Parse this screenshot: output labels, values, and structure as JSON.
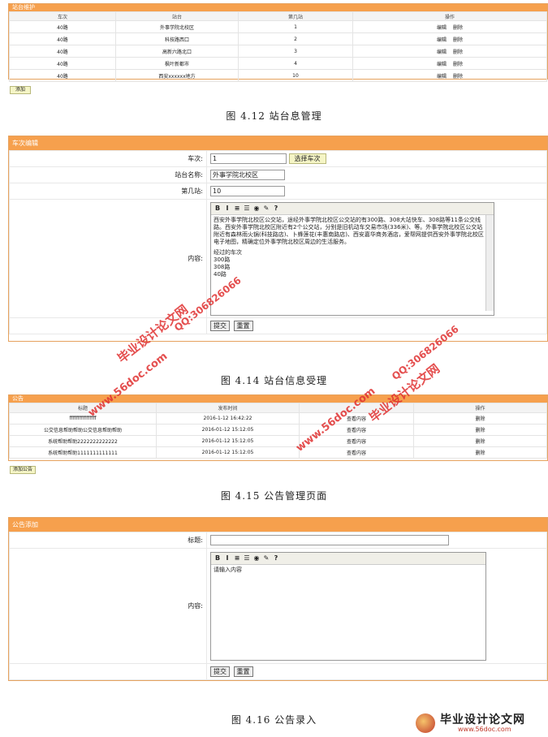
{
  "station_panel": {
    "title": "站台维护",
    "headers": [
      "车次",
      "站台",
      "第几站",
      "操作"
    ],
    "rows": [
      [
        "40路",
        "外事学院北校区",
        "1"
      ],
      [
        "40路",
        "科技路西口",
        "2"
      ],
      [
        "40路",
        "高新六路北口",
        "3"
      ],
      [
        "40路",
        "枫叶新都市",
        "4"
      ],
      [
        "40路",
        "西安xxxxxx地方",
        "10"
      ]
    ],
    "edit_label": "编辑",
    "delete_label": "删除",
    "add_label": "添加"
  },
  "caption1": "图 4.12 站台息管理",
  "bus_edit": {
    "title": "车次编辑",
    "bus_label": "车次:",
    "bus_value": "1",
    "select_bus_label": "选择车次",
    "station_label": "站台名称:",
    "station_value": "外事学院北校区",
    "order_label": "第几站:",
    "order_value": "10",
    "content_label": "内容:",
    "content_text": "西安外事学院北校区公交站，途经外事学院北校区公交站的有300路、308大站快车、308路等11条公交线路。西安外事学院北校区附近有2个公交站，分别是旧机动车交易市场(336米)、等。外事学院北校区公交站附近有森林雨火锅(科技路店)、卜蜂莲花(丰惠南路店)、西安嘉华商务酒店，爱帮网提供西安外事学院北校区电子地图，精确定位外事学院北校区周边的生活服务。",
    "content_lines": [
      "经过的车次",
      "300路",
      "308路",
      "40路"
    ],
    "submit_label": "提交",
    "reset_label": "重置"
  },
  "caption2": "图 4.14 站台信息受理",
  "notice_panel": {
    "title": "公告",
    "headers": [
      "标题",
      "发布时间",
      "",
      "操作"
    ],
    "rows": [
      [
        "ffffffffffffffff",
        "2016-1-12 16:42:22"
      ],
      [
        "公交信息帮助帮助公交信息帮助帮助",
        "2016-01-12 15:12:05"
      ],
      [
        "系统帮助帮助2222222222222",
        "2016-01-12 15:12:05"
      ],
      [
        "系统帮助帮助1111111111111",
        "2016-01-12 15:12:05"
      ]
    ],
    "view_label": "查看内容",
    "delete_label": "删除",
    "add_label": "添加公告"
  },
  "caption3": "图 4.15 公告管理页面",
  "notice_add": {
    "title": "公告添加",
    "title_label": "标题:",
    "content_label": "内容:",
    "content_placeholder": "请输入内容",
    "submit_label": "提交",
    "reset_label": "重置"
  },
  "caption4": "图 4.16 公告录入",
  "watermarks": {
    "site": "www.56doc.com",
    "qq": "QQ:306826066",
    "brand": "毕业设计论文网"
  },
  "logo": {
    "text": "毕业设计论文网",
    "url": "www.56doc.com"
  },
  "editor_toolbar": [
    "B",
    "I",
    "≡",
    "☰",
    "◉",
    "✎",
    "?"
  ]
}
